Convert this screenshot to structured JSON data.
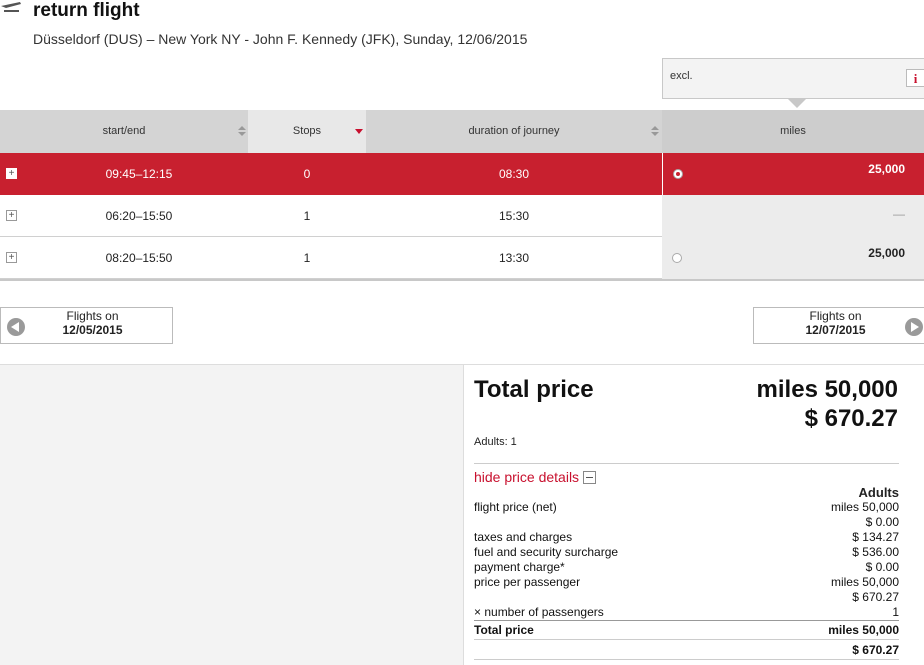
{
  "header": {
    "title": "return flight",
    "route": "Düsseldorf (DUS) – New York NY - John F. Kennedy (JFK),  Sunday, 12/06/2015"
  },
  "fare_tab": {
    "label": "excl.",
    "info_icon": "i"
  },
  "table": {
    "columns": [
      "start/end",
      "Stops",
      "duration of journey",
      "miles"
    ],
    "rows": [
      {
        "time": "09:45–12:15",
        "stops": "0",
        "duration": "08:30",
        "miles": "25,000",
        "selected": true
      },
      {
        "time": "06:20–15:50",
        "stops": "1",
        "duration": "15:30",
        "miles": "—",
        "selected": false
      },
      {
        "time": "08:20–15:50",
        "stops": "1",
        "duration": "13:30",
        "miles": "25,000",
        "selected": false
      }
    ]
  },
  "nav": {
    "prev": {
      "label": "Flights on",
      "date": "12/05/2015"
    },
    "next": {
      "label": "Flights on",
      "date": "12/07/2015"
    }
  },
  "price": {
    "total_label": "Total price",
    "total_miles": "miles 50,000",
    "total_usd": "$ 670.27",
    "adults": "Adults: 1",
    "hide_details": "hide price details",
    "details_header": "Adults",
    "lines": [
      {
        "label": "flight price (net)",
        "values": [
          "miles 50,000",
          "$ 0.00"
        ]
      },
      {
        "label": "taxes and charges",
        "values": [
          "$ 134.27"
        ]
      },
      {
        "label": "fuel and security surcharge",
        "values": [
          "$ 536.00"
        ]
      },
      {
        "label": "payment charge*",
        "values": [
          "$ 0.00"
        ]
      },
      {
        "label": "price per passenger",
        "values": [
          "miles 50,000",
          "$ 670.27"
        ]
      },
      {
        "label": "× number of passengers",
        "values": [
          "1"
        ]
      }
    ],
    "final": {
      "label": "Total price",
      "miles": "miles 50,000",
      "usd": "$ 670.27"
    }
  },
  "colors": {
    "accent": "#c8202f",
    "header_bg": "#d4d4d4"
  }
}
